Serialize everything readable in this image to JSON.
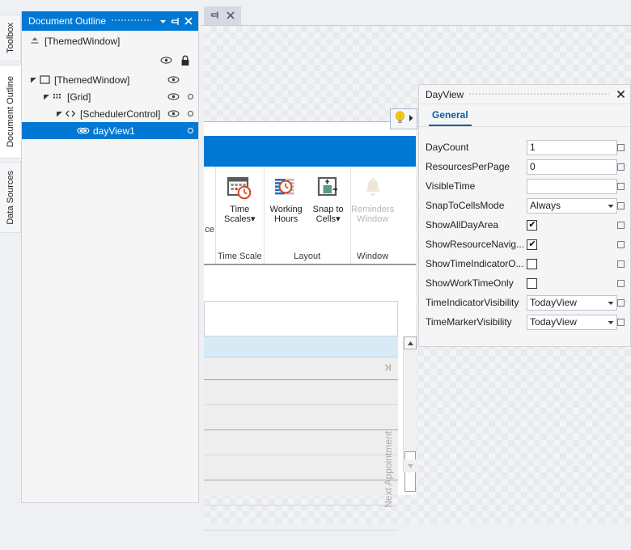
{
  "vertical_tabs": [
    {
      "label": "Toolbox",
      "name": "toolbox"
    },
    {
      "label": "Document Outline",
      "name": "document-outline"
    },
    {
      "label": "Data Sources",
      "name": "data-sources"
    }
  ],
  "outline_panel": {
    "title": "Document Outline",
    "header_buttons": [
      {
        "name": "dropdown",
        "glyph": "chevron-down-icon"
      },
      {
        "name": "pin",
        "glyph": "pin-icon"
      },
      {
        "name": "close",
        "glyph": "close-icon"
      }
    ],
    "parent_row": {
      "label": "[ThemedWindow]",
      "icon": "navigate-to-parent-icon"
    },
    "tree": [
      {
        "label": "[ThemedWindow]",
        "icon": "window-icon",
        "indent": 0,
        "expanded": true,
        "selected": false,
        "eye": true,
        "lock": false,
        "dot": false
      },
      {
        "label": "[Grid]",
        "icon": "grid-icon",
        "indent": 1,
        "expanded": true,
        "selected": false,
        "eye": true,
        "lock": false,
        "dot": true
      },
      {
        "label": "[SchedulerControl]",
        "icon": "code-icon",
        "indent": 2,
        "expanded": true,
        "selected": false,
        "eye": true,
        "lock": false,
        "dot": true
      },
      {
        "label": "dayView1",
        "icon": "dayview-icon",
        "indent": 3,
        "expanded": false,
        "selected": true,
        "eye": false,
        "lock": false,
        "dot": true
      }
    ]
  },
  "document_tab": {
    "buttons": [
      {
        "name": "pin",
        "glyph": "pin-icon"
      },
      {
        "name": "close",
        "glyph": "close-icon"
      }
    ]
  },
  "smart_tag": {
    "icon": "lightbulb-icon",
    "expander": "triangle-right-icon"
  },
  "ribbon": {
    "edge_label": "ce",
    "groups": [
      {
        "label": "Time Scale",
        "buttons": [
          {
            "line1": "Time",
            "line2": "Scales",
            "icon": "calendar-clock-icon",
            "dropdown": true,
            "disabled": false
          }
        ]
      },
      {
        "label": "Layout",
        "buttons": [
          {
            "line1": "Working",
            "line2": "Hours",
            "icon": "working-hours-icon",
            "dropdown": false,
            "disabled": false
          },
          {
            "line1": "Snap to",
            "line2": "Cells",
            "icon": "snap-to-cells-icon",
            "dropdown": true,
            "disabled": false
          }
        ]
      },
      {
        "label": "Window",
        "buttons": [
          {
            "line1": "Reminders",
            "line2": "Window",
            "icon": "bell-icon",
            "dropdown": false,
            "disabled": true
          }
        ]
      }
    ]
  },
  "scheduler": {
    "next_appointment_label": "Next Appointment",
    "nav_glyph": "next-appointment-arrow-icon",
    "scroll_up": "scroll-up-icon",
    "scroll_down": "scroll-down-icon"
  },
  "properties": {
    "title": "DayView",
    "close_glyph": "close-icon",
    "tabs": [
      {
        "label": "General",
        "active": true
      }
    ],
    "rows": [
      {
        "label": "DayCount",
        "type": "text",
        "value": "1"
      },
      {
        "label": "ResourcesPerPage",
        "type": "text",
        "value": "0"
      },
      {
        "label": "VisibleTime",
        "type": "text",
        "value": ""
      },
      {
        "label": "SnapToCellsMode",
        "type": "combo",
        "value": "Always"
      },
      {
        "label": "ShowAllDayArea",
        "type": "checkbox",
        "value": true
      },
      {
        "label": "ShowResourceNavig...",
        "type": "checkbox",
        "value": true
      },
      {
        "label": "ShowTimeIndicatorO...",
        "type": "checkbox",
        "value": false
      },
      {
        "label": "ShowWorkTimeOnly",
        "type": "checkbox",
        "value": false
      },
      {
        "label": "TimeIndicatorVisibility",
        "type": "combo",
        "value": "TodayView"
      },
      {
        "label": "TimeMarkerVisibility",
        "type": "combo",
        "value": "TodayView"
      }
    ]
  },
  "colors": {
    "accent": "#0078d4",
    "selection": "#0078d4",
    "panel_bg": "#f5f5f5",
    "app_bg": "#eef0f4",
    "tab_active_text": "#0a5ca8",
    "highlight_row": "#d9eaf7"
  }
}
